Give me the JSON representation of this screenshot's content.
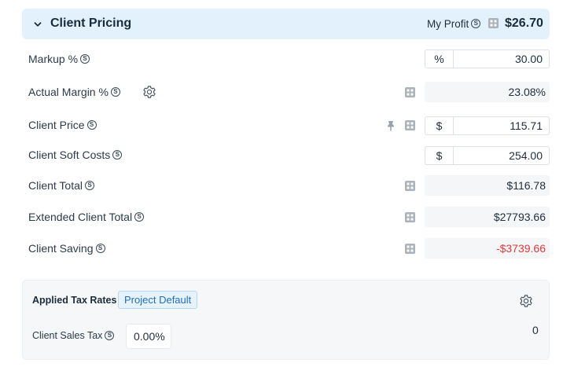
{
  "header": {
    "title": "Client Pricing",
    "profit_label": "My Profit",
    "profit_value": "$26.70"
  },
  "rows": {
    "markup": {
      "label": "Markup %",
      "prefix": "%",
      "value": "30.00"
    },
    "actual_margin": {
      "label": "Actual Margin %",
      "value": "23.08%"
    },
    "client_price": {
      "label": "Client Price",
      "prefix": "$",
      "value": "115.71"
    },
    "client_soft_costs": {
      "label": "Client Soft Costs",
      "prefix": "$",
      "value": "254.00"
    },
    "client_total": {
      "label": "Client Total",
      "value": "$116.78"
    },
    "extended_client_total": {
      "label": "Extended Client Total",
      "value": "$27793.66"
    },
    "client_saving": {
      "label": "Client Saving",
      "value": "-$3739.66"
    }
  },
  "tax": {
    "title": "Applied Tax Rates",
    "badge": "Project Default",
    "sales_tax_label": "Client Sales Tax",
    "sales_tax_value": "0.00%",
    "amount": "0"
  },
  "icons": {
    "expand": "chevron-down-icon",
    "info": "s-circle-icon",
    "calculator": "calculator-icon",
    "settings": "gear-icon",
    "pin": "pin-icon"
  },
  "colors": {
    "header_bg": "#e3f1fc",
    "negative": "#e03a3a",
    "badge_text": "#1f6fb8",
    "readonly_bg": "#f5f6f7"
  }
}
